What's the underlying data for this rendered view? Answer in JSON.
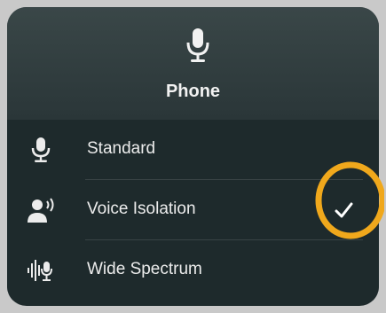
{
  "header": {
    "title": "Phone",
    "icon": "microphone-icon"
  },
  "modes": [
    {
      "label": "Standard",
      "icon": "microphone-icon",
      "selected": false
    },
    {
      "label": "Voice Isolation",
      "icon": "person-voice-icon",
      "selected": true
    },
    {
      "label": "Wide Spectrum",
      "icon": "waveform-microphone-icon",
      "selected": false
    }
  ],
  "colors": {
    "panel_background": "#1e2a2c",
    "header_background": "#3a4748",
    "text": "#ececec",
    "highlight_ring": "#f0a81c"
  }
}
